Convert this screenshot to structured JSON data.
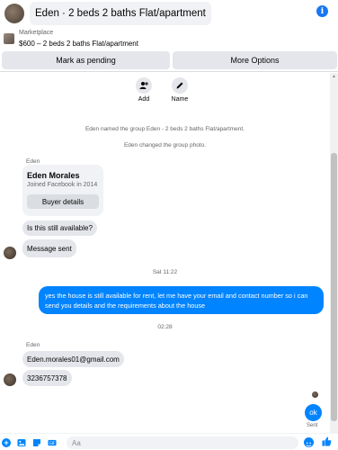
{
  "header": {
    "title": "Eden · 2 beds 2 baths Flat/apartment"
  },
  "listing": {
    "source": "Marketplace",
    "title": "$600 – 2 beds 2 baths Flat/apartment"
  },
  "actions": {
    "pending_label": "Mark as pending",
    "more_label": "More Options"
  },
  "quick_actions": {
    "add_label": "Add",
    "name_label": "Name"
  },
  "system_messages": [
    "Eden named the group Eden - 2 beds 2 baths Flat/apartment.",
    "Eden changed the group photo."
  ],
  "thread": {
    "first_sender": "Eden",
    "profile": {
      "name": "Eden Morales",
      "joined": "Joined Facebook in 2014",
      "button_label": "Buyer details"
    },
    "msg_available": "Is this still available?",
    "msg_sent": "Message sent",
    "timestamp_1": "Sat 11:22",
    "outgoing_text": "yes the house is still available for rent, let me have your email  and contact number so i can send you details and the requirements about the house",
    "timestamp_2": "02:28",
    "second_sender": "Eden",
    "msg_email": "Eden.morales01@gmail.com",
    "msg_phone": "3236757378",
    "reply": "ok",
    "reply_status": "Sent"
  },
  "composer": {
    "placeholder": "Aa"
  },
  "colors": {
    "accent": "#0084ff",
    "bubble_in": "#e4e6eb",
    "muted_text": "#65676b"
  }
}
